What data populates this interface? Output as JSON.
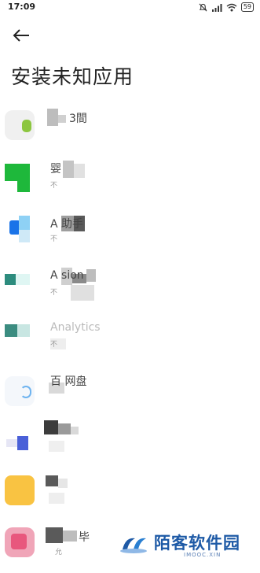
{
  "status_bar": {
    "time": "17:09",
    "battery": "59"
  },
  "page_title": "安装未知应用",
  "apps": [
    {
      "name": "3間 ",
      "sub": ""
    },
    {
      "name": "婴",
      "sub": "不"
    },
    {
      "name": "A    助手",
      "sub": "不"
    },
    {
      "name": "A   sion",
      "sub": "不"
    },
    {
      "name": "Analytics",
      "sub": "不"
    },
    {
      "name": "百  网盘",
      "sub": ""
    },
    {
      "name": "",
      "sub": ""
    },
    {
      "name": "",
      "sub": ""
    },
    {
      "name": "毕 ",
      "sub": "允"
    }
  ],
  "watermark": {
    "text": "陌客软件园",
    "url": "IMOOC.XIN"
  }
}
